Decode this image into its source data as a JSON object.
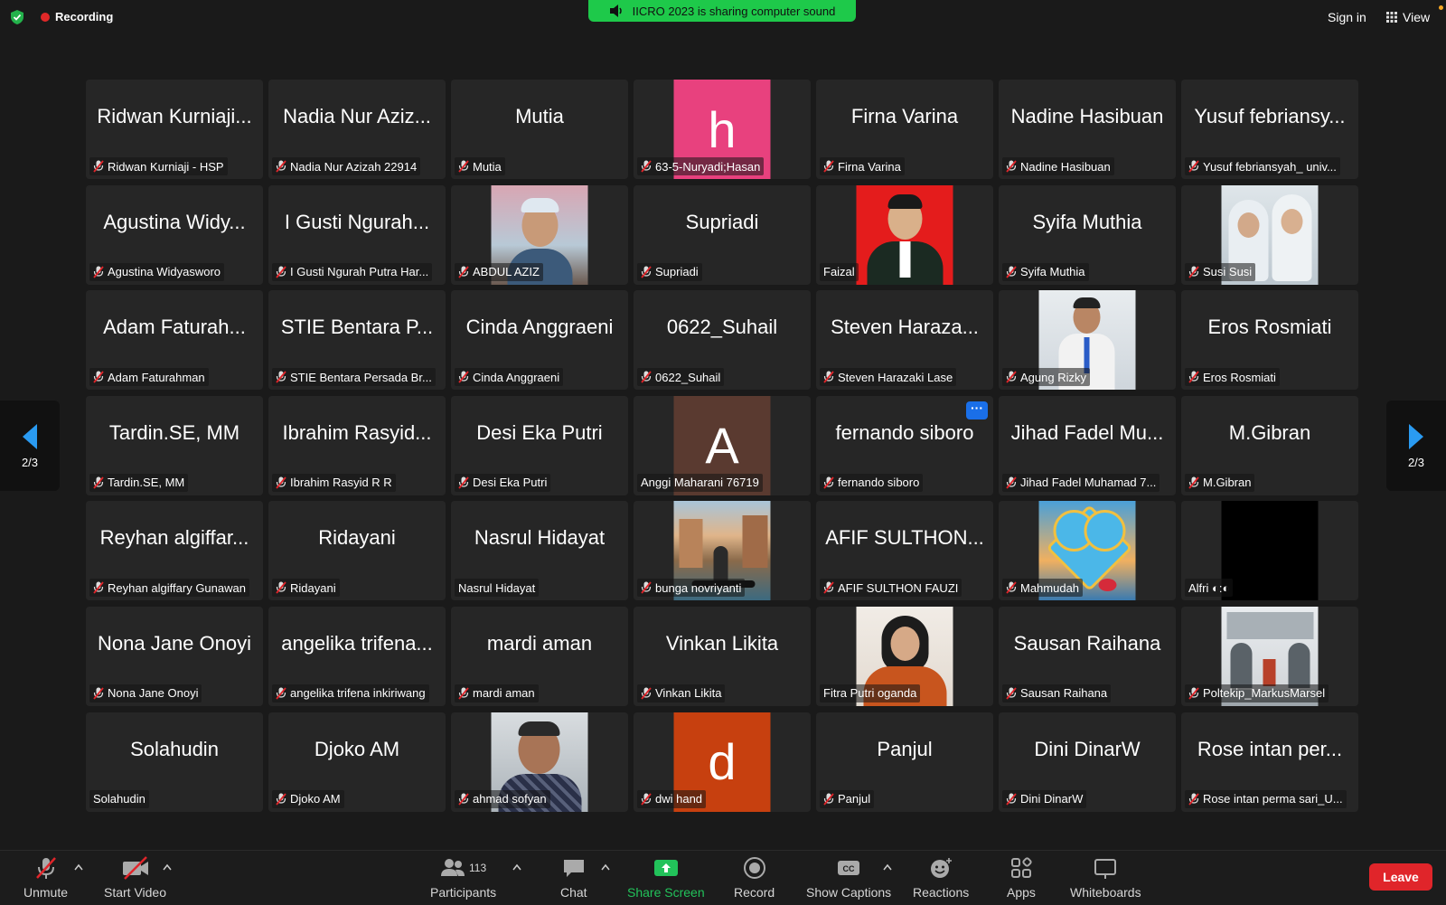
{
  "topbar": {
    "recording_label": "Recording",
    "share_banner": "IICRO 2023 is sharing computer sound",
    "sign_in": "Sign in",
    "view_label": "View"
  },
  "pager": {
    "left_page": "2/3",
    "right_page": "2/3"
  },
  "tiles": [
    {
      "big": "Ridwan Kurniaji...",
      "label": "Ridwan Kurniaji - HSP",
      "muted": true
    },
    {
      "big": "Nadia Nur Aziz...",
      "label": "Nadia Nur Azizah 22914",
      "muted": true
    },
    {
      "big": "Mutia",
      "label": "Mutia",
      "muted": true
    },
    {
      "big": "",
      "label": "63-5-Nuryadi;Hasan",
      "muted": true,
      "avatar_letter": "h",
      "avatar_color": "#e8417e"
    },
    {
      "big": "Firna Varina",
      "label": "Firna Varina",
      "muted": true
    },
    {
      "big": "Nadine Hasibuan",
      "label": "Nadine Hasibuan",
      "muted": true
    },
    {
      "big": "Yusuf febriansy...",
      "label": "Yusuf febriansyah_ univ...",
      "muted": true
    },
    {
      "big": "Agustina Widy...",
      "label": "Agustina Widyasworo",
      "muted": true
    },
    {
      "big": "I Gusti Ngurah...",
      "label": "I Gusti Ngurah Putra Har...",
      "muted": true
    },
    {
      "big": "",
      "label": "ABDUL AZIZ",
      "muted": true,
      "photo": "photo-man-cap"
    },
    {
      "big": "Supriadi",
      "label": "Supriadi",
      "muted": true
    },
    {
      "big": "",
      "label": "Faizal",
      "muted": false,
      "photo": "photo-red-suit"
    },
    {
      "big": "Syifa Muthia",
      "label": "Syifa Muthia",
      "muted": true
    },
    {
      "big": "",
      "label": "Susi Susi",
      "muted": true,
      "photo": "photo-two-women"
    },
    {
      "big": "Adam Faturah...",
      "label": "Adam Faturahman",
      "muted": true
    },
    {
      "big": "STIE Bentara P...",
      "label": "STIE Bentara Persada Br...",
      "muted": true
    },
    {
      "big": "Cinda Anggraeni",
      "label": "Cinda Anggraeni",
      "muted": true
    },
    {
      "big": "0622_Suhail",
      "label": "0622_Suhail",
      "muted": true
    },
    {
      "big": "Steven Haraza...",
      "label": "Steven Harazaki Lase",
      "muted": true
    },
    {
      "big": "",
      "label": "Agung Rizky",
      "muted": true,
      "photo": "photo-young-man"
    },
    {
      "big": "Eros Rosmiati",
      "label": "Eros Rosmiati",
      "muted": true
    },
    {
      "big": "Tardin.SE, MM",
      "label": "Tardin.SE, MM",
      "muted": true
    },
    {
      "big": "Ibrahim Rasyid...",
      "label": "Ibrahim Rasyid R R",
      "muted": true
    },
    {
      "big": "Desi Eka Putri",
      "label": "Desi Eka Putri",
      "muted": true
    },
    {
      "big": "",
      "label": "Anggi Maharani 76719",
      "muted": false,
      "avatar_letter": "A",
      "avatar_color": "#5a3a30"
    },
    {
      "big": "fernando siboro",
      "label": "fernando siboro",
      "muted": true,
      "more": true
    },
    {
      "big": "Jihad Fadel Mu...",
      "label": "Jihad Fadel Muhamad 7...",
      "muted": true
    },
    {
      "big": "M.Gibran",
      "label": "M.Gibran",
      "muted": true
    },
    {
      "big": "Reyhan algiffar...",
      "label": "Reyhan algiffary Gunawan",
      "muted": true
    },
    {
      "big": "Ridayani",
      "label": "Ridayani",
      "muted": true
    },
    {
      "big": "Nasrul Hidayat",
      "label": "Nasrul Hidayat",
      "muted": false
    },
    {
      "big": "",
      "label": "bunga novriyanti",
      "muted": true,
      "photo": "photo-venice"
    },
    {
      "big": "AFIF SULTHON...",
      "label": "AFIF SULTHON FAUZI",
      "muted": true
    },
    {
      "big": "",
      "label": "Mahmudah",
      "muted": true,
      "photo": "photo-heart"
    },
    {
      "big": "",
      "label": "Alfri ◐:◐",
      "muted": false,
      "photo": "photo-black"
    },
    {
      "big": "Nona Jane Onoyi",
      "label": "Nona Jane Onoyi",
      "muted": true
    },
    {
      "big": "angelika trifena...",
      "label": "angelika trifena inkiriwang",
      "muted": true
    },
    {
      "big": "mardi aman",
      "label": "mardi aman",
      "muted": true
    },
    {
      "big": "Vinkan Likita",
      "label": "Vinkan Likita",
      "muted": true
    },
    {
      "big": "",
      "label": "Fitra Putri oganda",
      "muted": false,
      "photo": "photo-hijab"
    },
    {
      "big": "Sausan Raihana",
      "label": "Sausan Raihana",
      "muted": true
    },
    {
      "big": "",
      "label": "Poltekip_MarkusMarsel",
      "muted": true,
      "photo": "photo-building"
    },
    {
      "big": "Solahudin",
      "label": "Solahudin",
      "muted": false
    },
    {
      "big": "Djoko AM",
      "label": "Djoko AM",
      "muted": true
    },
    {
      "big": "",
      "label": "ahmad sofyan",
      "muted": true,
      "photo": "photo-man-batik"
    },
    {
      "big": "",
      "label": "dwi hand",
      "muted": true,
      "avatar_letter": "d",
      "avatar_color": "#c7400f"
    },
    {
      "big": "Panjul",
      "label": "Panjul",
      "muted": true
    },
    {
      "big": "Dini DinarW",
      "label": "Dini DinarW",
      "muted": true
    },
    {
      "big": "Rose intan per...",
      "label": "Rose intan perma sari_U...",
      "muted": true
    }
  ],
  "toolbar": {
    "unmute": "Unmute",
    "start_video": "Start Video",
    "participants": "Participants",
    "participants_count": "113",
    "chat": "Chat",
    "share_screen": "Share Screen",
    "record": "Record",
    "show_captions": "Show Captions",
    "reactions": "Reactions",
    "apps": "Apps",
    "whiteboards": "Whiteboards",
    "leave": "Leave"
  }
}
